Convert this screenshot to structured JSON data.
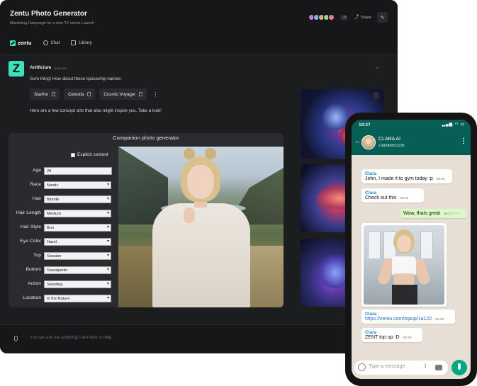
{
  "header": {
    "title": "Zentu Photo Generator",
    "subtitle": "Marketing Campaign for a new TV series Launch",
    "avatar_count": "+4",
    "share_label": "Share"
  },
  "nav": {
    "logo": "zentu",
    "items": [
      {
        "label": "Chat",
        "icon": "chat-icon"
      },
      {
        "label": "Library",
        "icon": "folder-icon"
      }
    ]
  },
  "message": {
    "author": "Artificium",
    "time": "just now",
    "intro": "Sure thing! How about these spaceship names:",
    "chips": [
      "Starfire",
      "Celestia",
      "Cosmic Voyager"
    ],
    "outro": "Here are a few concept arts that also might inspire you. Take a look!"
  },
  "generator": {
    "title": "Companion photo generator",
    "explicit_label": "Explicit content",
    "explicit_checked": false,
    "fields": [
      {
        "label": "Age",
        "value": "28",
        "type": "text"
      },
      {
        "label": "Race",
        "value": "Nordic",
        "type": "select"
      },
      {
        "label": "Hair",
        "value": "Blonde",
        "type": "select"
      },
      {
        "label": "Hair Length",
        "value": "Medium",
        "type": "select"
      },
      {
        "label": "Hair Style",
        "value": "Bun",
        "type": "select"
      },
      {
        "label": "Eye Color",
        "value": "Hazel",
        "type": "select"
      },
      {
        "label": "Top",
        "value": "Sweater",
        "type": "select"
      },
      {
        "label": "Bottom",
        "value": "Sweatpants",
        "type": "select"
      },
      {
        "label": "Action",
        "value": "Standing",
        "type": "select"
      },
      {
        "label": "Location",
        "value": "In the Nature",
        "type": "select"
      }
    ]
  },
  "composer": {
    "placeholder": "You can ask me anything! I am here to help."
  },
  "phone": {
    "time": "19:27",
    "contact_name": "CLARA AI",
    "contact_phone": "+38348501295",
    "messages": [
      {
        "from": "Clara",
        "text": "John, I made it to gym today :p",
        "time": "09:25"
      },
      {
        "from": "Clara",
        "text": "Check out this",
        "time": "09:25"
      },
      {
        "from": "me",
        "text": "Wow, thats great",
        "time": "09:27"
      },
      {
        "from": "Clara",
        "text": "",
        "image": "gym-selfie"
      },
      {
        "from": "Clara",
        "text": "https://zentu.com/topup/1a122",
        "time": "09:30"
      },
      {
        "from": "Clara",
        "text": "ZENT top up :D",
        "time": "09:30"
      }
    ],
    "input_placeholder": "Type a message"
  },
  "colors": {
    "accent": "#3ee0c0",
    "whatsapp_header": "#075e54",
    "whatsapp_send": "#00a884",
    "outgoing_bubble": "#dcf8c6"
  }
}
